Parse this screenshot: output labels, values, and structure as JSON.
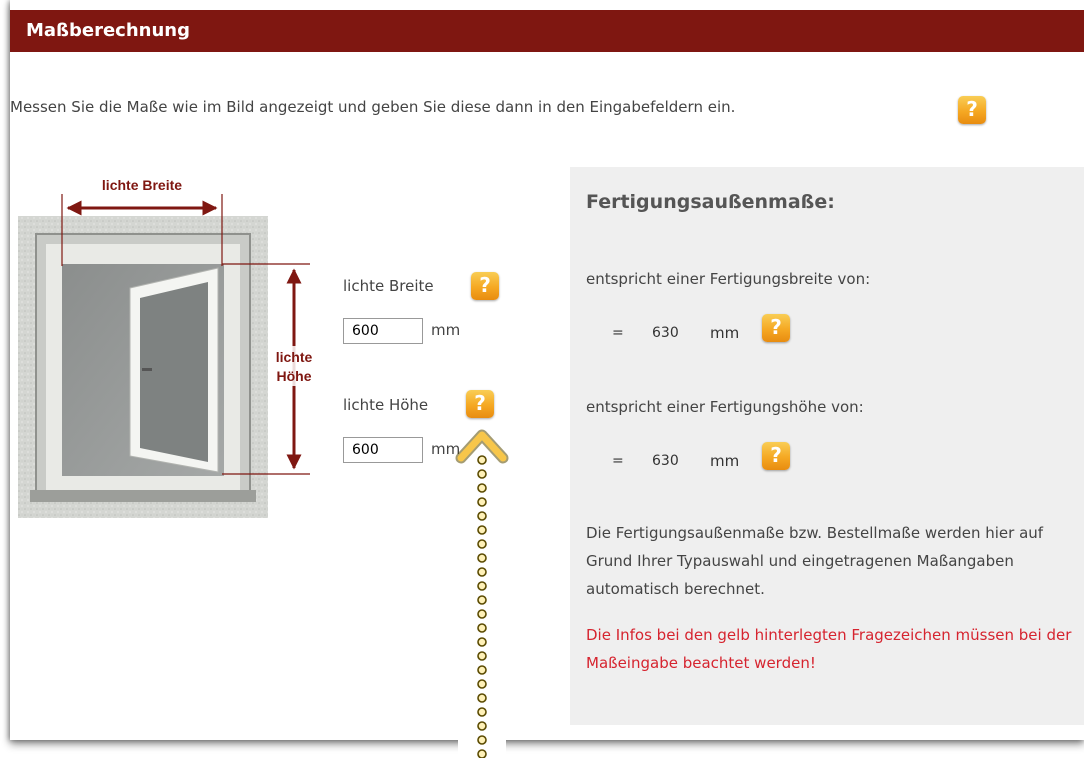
{
  "header": {
    "title": "Maßberechnung"
  },
  "intro": {
    "text": "Messen Sie die Maße wie im Bild angezeigt und geben Sie diese dann in den Eingabefeldern ein."
  },
  "help_icon": {
    "glyph": "?",
    "color": "#f5a823"
  },
  "figure": {
    "label_width": "lichte Breite",
    "label_height_line1": "lichte",
    "label_height_line2": "Höhe",
    "arrow_color": "#7f1711"
  },
  "form": {
    "width_label": "lichte Breite",
    "width_value": "600",
    "width_unit": "mm",
    "height_label": "lichte Höhe",
    "height_value": "600",
    "height_unit": "mm"
  },
  "results": {
    "heading": "Fertigungsaußenmaße:",
    "width_text": "entspricht einer Fertigungsbreite von:",
    "width_eq": "=",
    "width_value": "630",
    "width_unit": "mm",
    "height_text": "entspricht einer Fertigungshöhe von:",
    "height_eq": "=",
    "height_value": "630",
    "height_unit": "mm",
    "description": "Die Fertigungsaußenmaße bzw. Bestellmaße werden hier auf Grund Ihrer Typauswahl und eingetragenen Maßangaben automatisch berechnet.",
    "warning": "Die Infos bei den gelb hinterlegten Fragezeichen müssen bei der Maßeingabe beachtet werden!",
    "warning_color": "#d6242f"
  },
  "colors": {
    "header_bg": "#7f1711",
    "box_bg": "#efefef"
  }
}
